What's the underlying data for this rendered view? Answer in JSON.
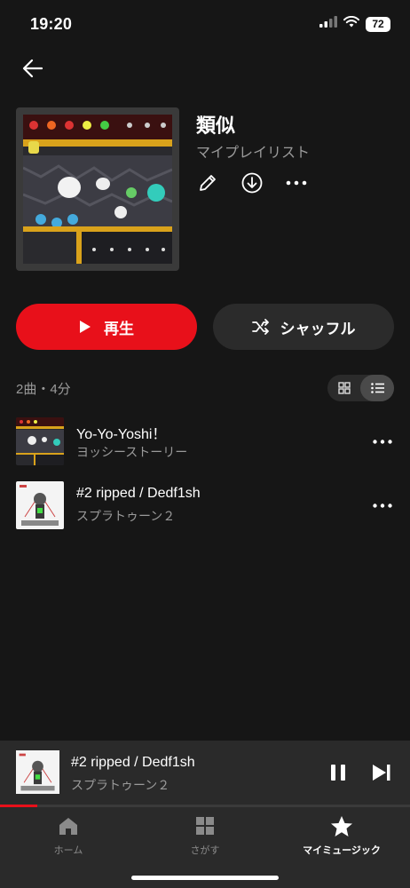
{
  "status": {
    "time": "19:20",
    "battery": "72"
  },
  "playlist": {
    "title": "類似",
    "subtitle": "マイプレイリスト",
    "play_label": "再生",
    "shuffle_label": "シャッフル",
    "count": "2曲・4分"
  },
  "tracks": [
    {
      "title": "Yo-Yo-Yoshi！",
      "subtitle": "ヨッシーストーリー"
    },
    {
      "title": "#2 ripped / Dedf1sh",
      "subtitle": "スプラトゥーン２"
    }
  ],
  "now_playing": {
    "title": "#2 ripped / Dedf1sh",
    "subtitle": "スプラトゥーン２",
    "progress": 0.09
  },
  "tabs": [
    {
      "label": "ホーム",
      "icon": "home-icon"
    },
    {
      "label": "さがす",
      "icon": "grid-icon"
    },
    {
      "label": "マイミュージック",
      "icon": "star-icon"
    }
  ],
  "colors": {
    "accent": "#e8101a",
    "background": "#161616",
    "surface": "#2a2a2a"
  }
}
